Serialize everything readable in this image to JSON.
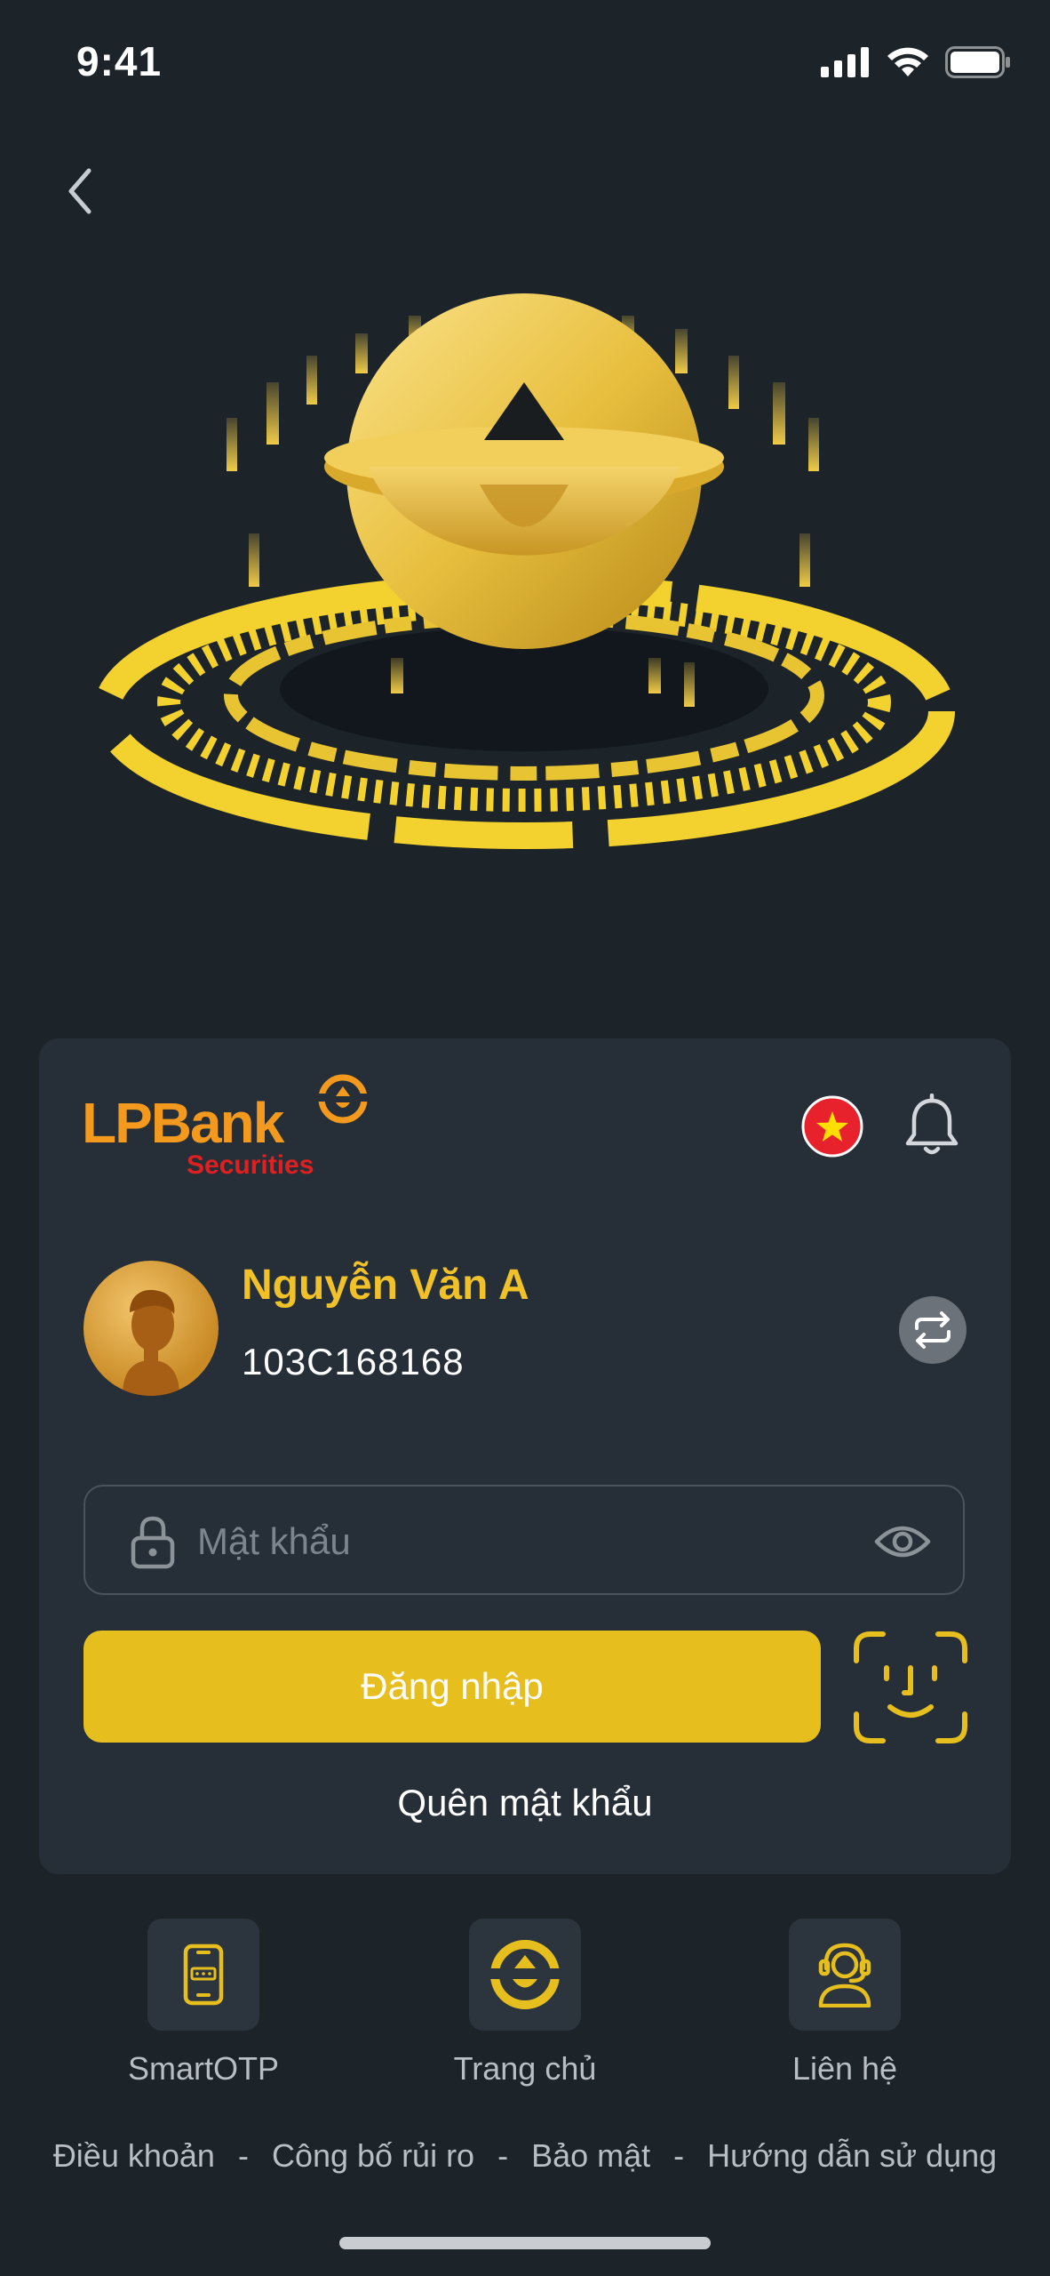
{
  "status_bar": {
    "time": "9:41",
    "icons": [
      "cellular-signal-icon",
      "wifi-icon",
      "battery-icon"
    ]
  },
  "nav": {
    "back_icon": "chevron-left-icon"
  },
  "brand": {
    "name": "LPBank",
    "sub": "Securities",
    "accent": "#f39a1e",
    "sub_color": "#e02020"
  },
  "header": {
    "language_icon": "vietnam-flag-icon",
    "notification_icon": "bell-icon"
  },
  "user": {
    "name": "Nguyễn Văn A",
    "account_id": "103C168168"
  },
  "login": {
    "password_placeholder": "Mật khẩu",
    "submit_label": "Đăng nhập",
    "forgot_label": "Quên mật khẩu",
    "biometric_icon": "face-id-icon"
  },
  "quick_actions": [
    {
      "label": "SmartOTP",
      "icon": "phone-otp-icon"
    },
    {
      "label": "Trang chủ",
      "icon": "lpbank-home-icon"
    },
    {
      "label": "Liên hệ",
      "icon": "support-agent-icon"
    }
  ],
  "footer": {
    "links": [
      "Điều khoản",
      "Công bố rủi ro",
      "Bảo mật",
      "Hướng dẫn sử dụng"
    ],
    "separator": "-"
  },
  "colors": {
    "background": "#1c2329",
    "card": "#262f37",
    "gold": "#e6bf1f",
    "name_gold": "#f0c128"
  }
}
